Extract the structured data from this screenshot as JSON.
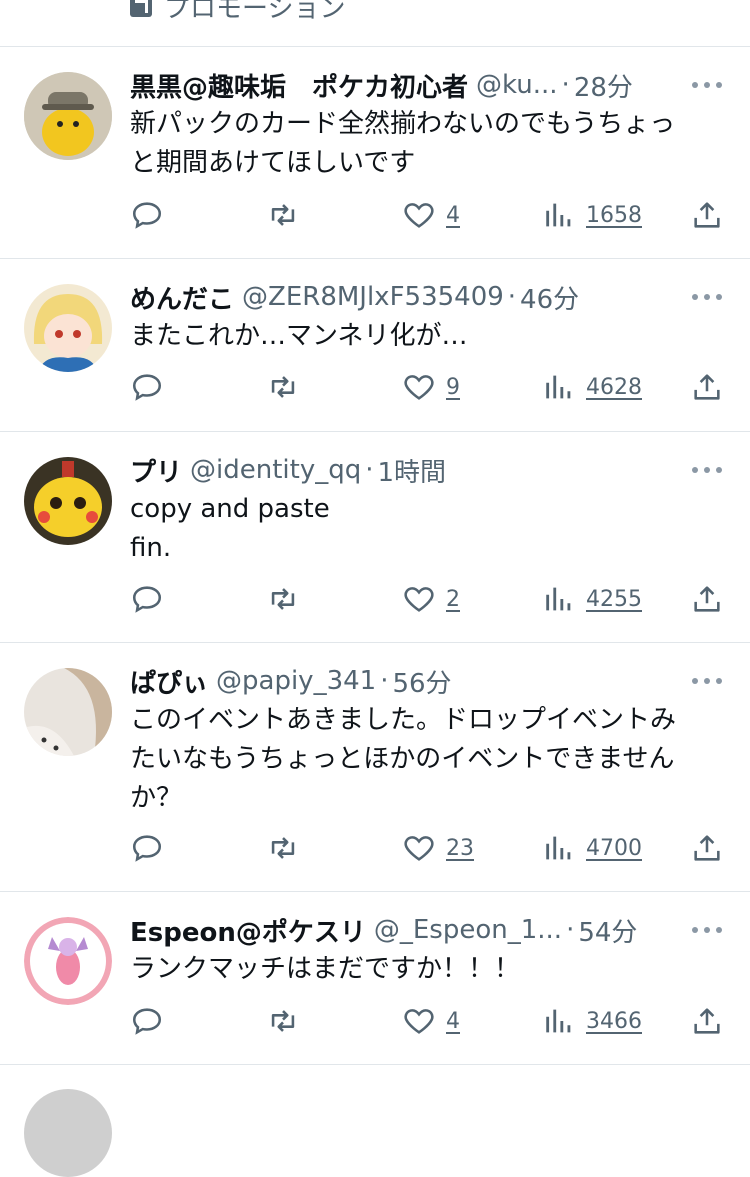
{
  "promo": {
    "label": "プロモーション"
  },
  "tweets": [
    {
      "name": "黒黒@趣味垢　ポケカ初心者",
      "handle": "@ku...",
      "time": "28分",
      "body": "新パックのカード全然揃わないのでもうちょっ\nと期間あけてほしいです",
      "likes": "4",
      "views": "1658"
    },
    {
      "name": "めんだこ",
      "handle": "@ZER8MJlxF535409",
      "time": "46分",
      "body": "またこれか…マンネリ化が…",
      "likes": "9",
      "views": "4628"
    },
    {
      "name": "プリ",
      "handle": "@identity_qq",
      "time": "1時間",
      "body": "copy and paste\nfin.",
      "likes": "2",
      "views": "4255"
    },
    {
      "name": "ぱぴぃ",
      "handle": "@papiy_341",
      "time": "56分",
      "body": "このイベントあきました。ドロップイベントみ\nたいなもうちょっとほかのイベントできません\nか？",
      "likes": "23",
      "views": "4700"
    },
    {
      "name": "Espeon@ポケスリ",
      "handle": "@_Espeon_1...",
      "time": "54分",
      "body": "ランクマッチはまだですか！！！",
      "likes": "4",
      "views": "3466"
    }
  ],
  "separator_dot": "·"
}
